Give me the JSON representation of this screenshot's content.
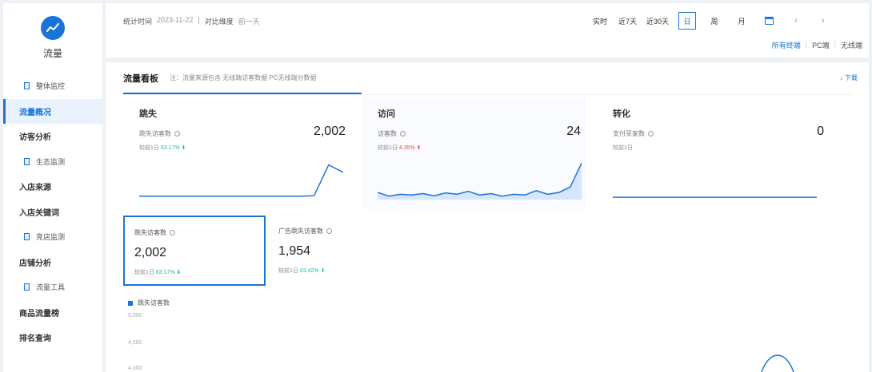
{
  "app": {
    "name": "流量"
  },
  "sidebar": {
    "items": [
      {
        "label": "整体监控",
        "type": "sub",
        "active": false
      },
      {
        "label": "流量概况",
        "type": "top",
        "active": true
      },
      {
        "label": "访客分析",
        "type": "top",
        "active": false
      },
      {
        "label": "生态监测",
        "type": "sub",
        "active": false
      },
      {
        "label": "入店来源",
        "type": "top",
        "active": false
      },
      {
        "label": "入店关键词",
        "type": "top",
        "active": false
      },
      {
        "label": "竞店监测",
        "type": "sub",
        "active": false
      },
      {
        "label": "店铺分析",
        "type": "top",
        "active": false
      },
      {
        "label": "流量工具",
        "type": "sub",
        "active": false
      },
      {
        "label": "商品流量榜",
        "type": "top",
        "active": false
      },
      {
        "label": "排名查询",
        "type": "top",
        "active": false
      }
    ]
  },
  "topbar": {
    "stat_date_label": "统计时间",
    "stat_date_value": "2023-11-22",
    "compare_label": "对比维度",
    "compare_value": "前一天",
    "time_buttons": [
      {
        "label": "实时",
        "active": false
      },
      {
        "label": "近7天",
        "active": false
      },
      {
        "label": "近30天",
        "active": false
      },
      {
        "label": "日",
        "active": true
      },
      {
        "label": "周",
        "active": false
      },
      {
        "label": "月",
        "active": false
      }
    ],
    "terminals": [
      {
        "label": "所有终端",
        "active": true
      },
      {
        "label": "PC端",
        "active": false
      },
      {
        "label": "无线端",
        "active": false
      }
    ]
  },
  "panel": {
    "title": "流量看板",
    "hint": "注：流量来源包含 无线端访客数据 PC无线端分数据",
    "download_label": "↓ 下载"
  },
  "cards": [
    {
      "title": "跳失",
      "label": "跳失访客数",
      "value": "2,002",
      "compare_label": "较前1日",
      "compare_value": "83.17%",
      "trend": "down",
      "trend_symbol": "⬇",
      "spark": [
        0.05,
        0.05,
        0.05,
        0.05,
        0.05,
        0.05,
        0.05,
        0.05,
        0.05,
        0.05,
        0.05,
        0.05,
        0.06,
        0.9,
        0.7
      ]
    },
    {
      "title": "访问",
      "label": "访客数",
      "value": "24",
      "compare_label": "较前1日",
      "compare_value": "4.35%",
      "trend": "up",
      "trend_symbol": "⬆",
      "spark": [
        0.15,
        0.05,
        0.1,
        0.08,
        0.12,
        0.06,
        0.14,
        0.1,
        0.18,
        0.08,
        0.12,
        0.05,
        0.1,
        0.08,
        0.2,
        0.1,
        0.15,
        0.3,
        0.95
      ]
    },
    {
      "title": "转化",
      "label": "支付买家数",
      "value": "0",
      "compare_label": "较前1日",
      "compare_value": "",
      "trend": "none",
      "trend_symbol": "",
      "spark": [
        0.02,
        0.02,
        0.02,
        0.02,
        0.02,
        0.02,
        0.02,
        0.02
      ]
    }
  ],
  "metric_cards": [
    {
      "label": "跳失访客数",
      "value": "2,002",
      "compare_label": "较前1日",
      "compare_value": "83.17%",
      "trend_symbol": "⬇"
    },
    {
      "label": "广告跳失访客数",
      "value": "1,954",
      "compare_label": "较前1日",
      "compare_value": "83.42%",
      "trend_symbol": "⬇"
    }
  ],
  "chart": {
    "legend": "跳失访客数",
    "y_ticks": [
      "5,000",
      "4,500",
      "4,000"
    ]
  },
  "colors": {
    "accent": "#1a73d9",
    "up": "#e5484d",
    "down": "#2bb7a4"
  }
}
